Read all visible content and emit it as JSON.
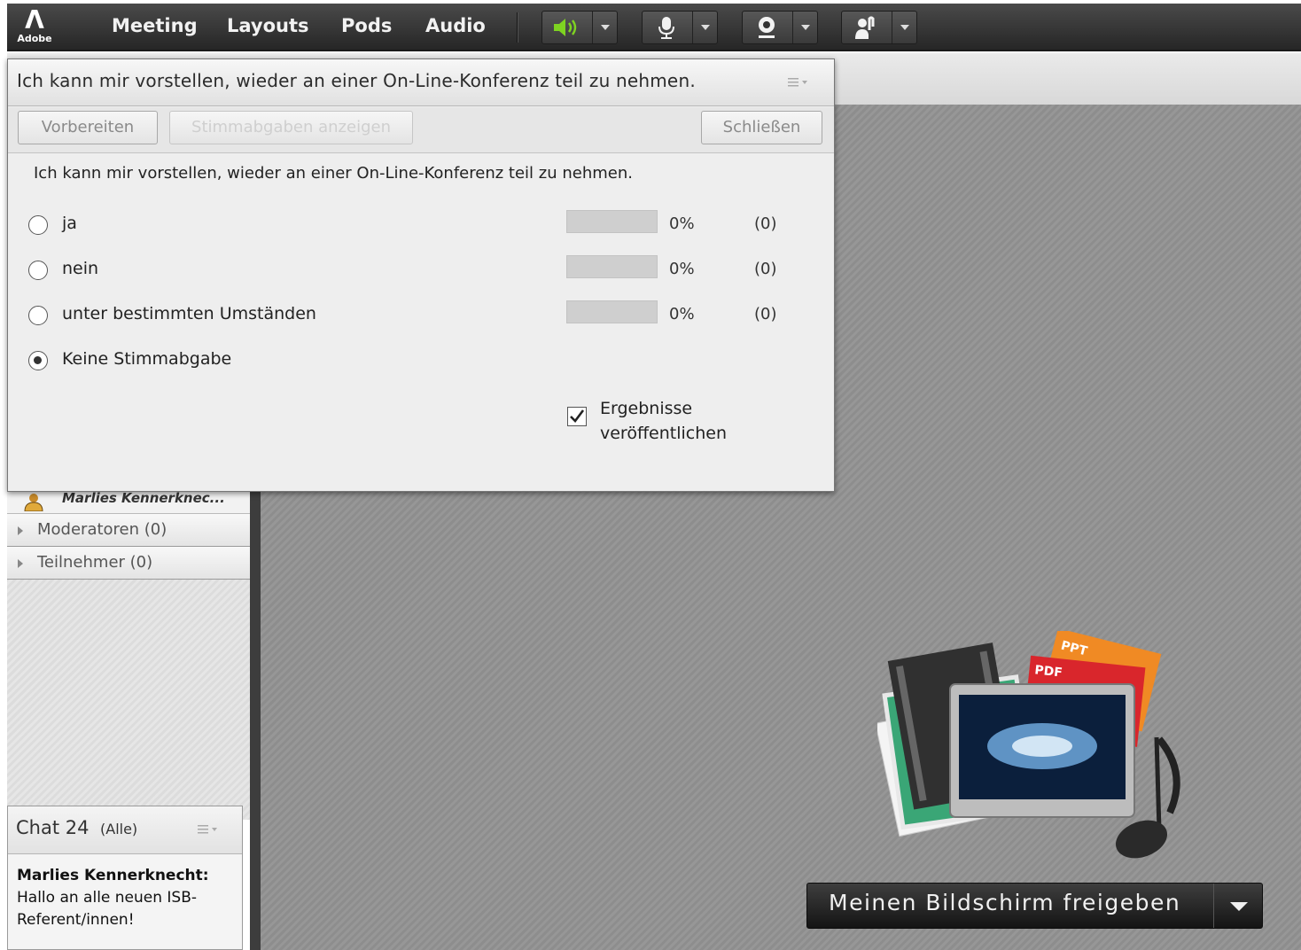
{
  "topbar": {
    "logo_text": "Adobe",
    "menus": [
      "Meeting",
      "Layouts",
      "Pods",
      "Audio"
    ],
    "tools": [
      {
        "icon": "speaker-icon",
        "active": true,
        "accent": "#7ed321"
      },
      {
        "icon": "microphone-icon",
        "active": false
      },
      {
        "icon": "webcam-icon",
        "active": false
      },
      {
        "icon": "raise-hand-icon",
        "active": false
      }
    ]
  },
  "poll": {
    "title": "Ich kann mir vorstellen, wieder an einer On-Line-Konferenz teil zu nehmen.",
    "buttons": {
      "prepare": "Vorbereiten",
      "show_votes": "Stimmabgaben anzeigen",
      "close": "Schließen"
    },
    "question": "Ich kann mir vorstellen, wieder an einer On-Line-Konferenz teil zu nehmen.",
    "options": [
      {
        "label": "ja",
        "percent": "0%",
        "count": "(0)",
        "share": 0,
        "selected": false
      },
      {
        "label": "nein",
        "percent": "0%",
        "count": "(0)",
        "share": 0,
        "selected": false
      },
      {
        "label": "unter bestimmten Umständen",
        "percent": "0%",
        "count": "(0)",
        "share": 0,
        "selected": false
      },
      {
        "label": "Keine Stimmabgabe",
        "selected": true
      }
    ],
    "publish_label_1": "Ergebnisse",
    "publish_label_2": "veröffentlichen",
    "publish_checked": true
  },
  "attendees": {
    "current_user": "Marlies Kennerknec...",
    "groups": [
      {
        "label": "Moderatoren (0)"
      },
      {
        "label": "Teilnehmer (0)"
      }
    ]
  },
  "chat": {
    "title": "Chat 24",
    "scope": "(Alle)",
    "message_author": "Marlies Kennerknecht:",
    "message_line1": "Hallo an alle neuen ISB-",
    "message_line2": "Referent/innen!"
  },
  "share": {
    "button_label": "Meinen Bildschirm freigeben",
    "art_labels": {
      "ppt": "PPT",
      "pdf": "PDF"
    }
  }
}
